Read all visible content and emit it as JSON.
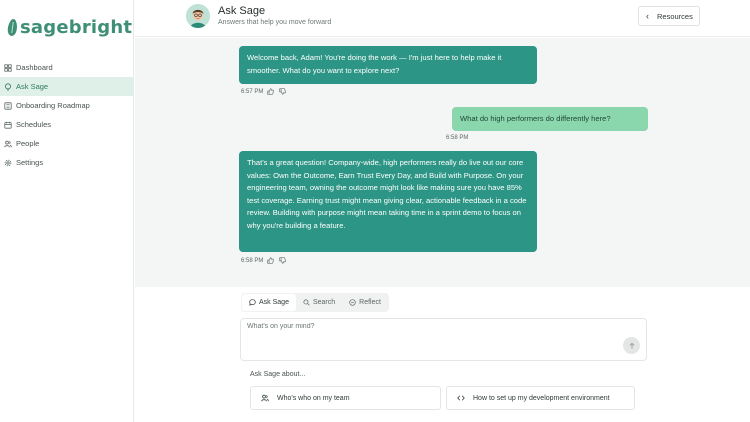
{
  "brand": {
    "name": "sagebright",
    "color": "#3f8f76"
  },
  "sidebar": {
    "items": [
      {
        "label": "Dashboard",
        "icon": "grid-icon",
        "active": false
      },
      {
        "label": "Ask Sage",
        "icon": "lightbulb-icon",
        "active": true
      },
      {
        "label": "Onboarding Roadmap",
        "icon": "list-icon",
        "active": false
      },
      {
        "label": "Schedules",
        "icon": "calendar-icon",
        "active": false
      },
      {
        "label": "People",
        "icon": "people-icon",
        "active": false
      },
      {
        "label": "Settings",
        "icon": "gear-icon",
        "active": false
      }
    ]
  },
  "header": {
    "title": "Ask Sage",
    "subtitle": "Answers that help you move forward",
    "resources_label": "Resources"
  },
  "chat": {
    "messages": [
      {
        "role": "bot",
        "text": "Welcome back, Adam! You're doing the work — I'm just here to help make it smoother. What do you want to explore next?",
        "time": "6:57 PM"
      },
      {
        "role": "user",
        "text": "What do high performers do differently here?",
        "time": "6:58 PM"
      },
      {
        "role": "bot",
        "text": "That's a great question! Company-wide, high performers really do live out our core values: Own the Outcome, Earn Trust Every Day, and Build with Purpose. On your engineering team, owning the outcome might look like making sure you have 85% test coverage. Earning trust might mean giving clear, actionable feedback in a code review. Building with purpose might mean taking time in a sprint demo to focus on why you're building a feature.",
        "time": "6:58 PM"
      }
    ],
    "colors": {
      "bot_bubble": "#2d9585",
      "user_bubble": "#8bd7ad"
    }
  },
  "composer": {
    "tabs": [
      {
        "label": "Ask Sage",
        "icon": "chat-bubble-icon",
        "active": true
      },
      {
        "label": "Search",
        "icon": "search-icon",
        "active": false
      },
      {
        "label": "Reflect",
        "icon": "reflect-circle-icon",
        "active": false
      }
    ],
    "placeholder": "What's on your mind?",
    "send_icon": "arrow-up-icon",
    "ask_about_label": "Ask Sage about...",
    "suggestions": [
      {
        "label": "Who's who on my team",
        "icon": "people-icon"
      },
      {
        "label": "How to set up my development environment",
        "icon": "code-icon"
      }
    ]
  }
}
